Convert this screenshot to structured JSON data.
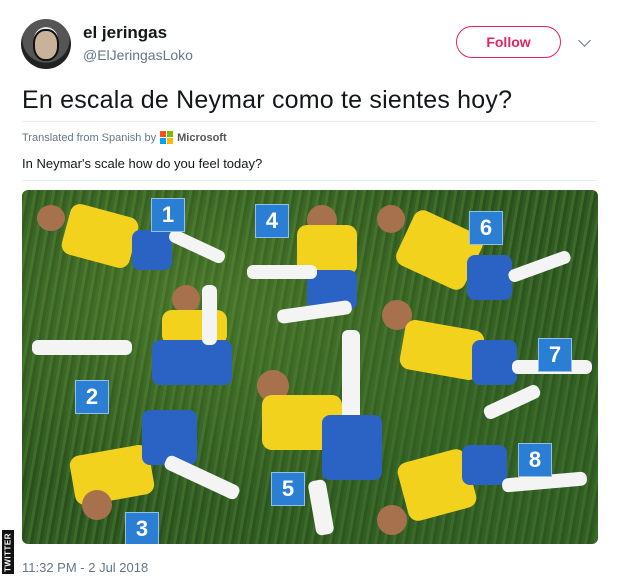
{
  "user": {
    "display_name": "el jeringas",
    "handle": "@ElJeringasLoko",
    "follow_label": "Follow"
  },
  "tweet": {
    "text": "En escala de Neymar como te sientes hoy?",
    "translated_prefix": "Translated from Spanish by",
    "translator_brand": "Microsoft",
    "translation": "In Neymar's scale how do you feel today?",
    "timestamp": "11:32 PM - 2 Jul 2018"
  },
  "media": {
    "badges": [
      "1",
      "2",
      "3",
      "4",
      "5",
      "6",
      "7",
      "8"
    ]
  },
  "watermark": "TWITTER",
  "colors": {
    "follow_accent": "#e0245e",
    "secondary_text": "#657786",
    "badge_blue": "#2a7fd4",
    "shirt_yellow": "#f3d21d",
    "shorts_blue": "#2a63c4",
    "pitch_green": "#2f5a22"
  },
  "icons": {
    "more": "chevron-down-icon",
    "translator": "microsoft-logo-icon"
  }
}
